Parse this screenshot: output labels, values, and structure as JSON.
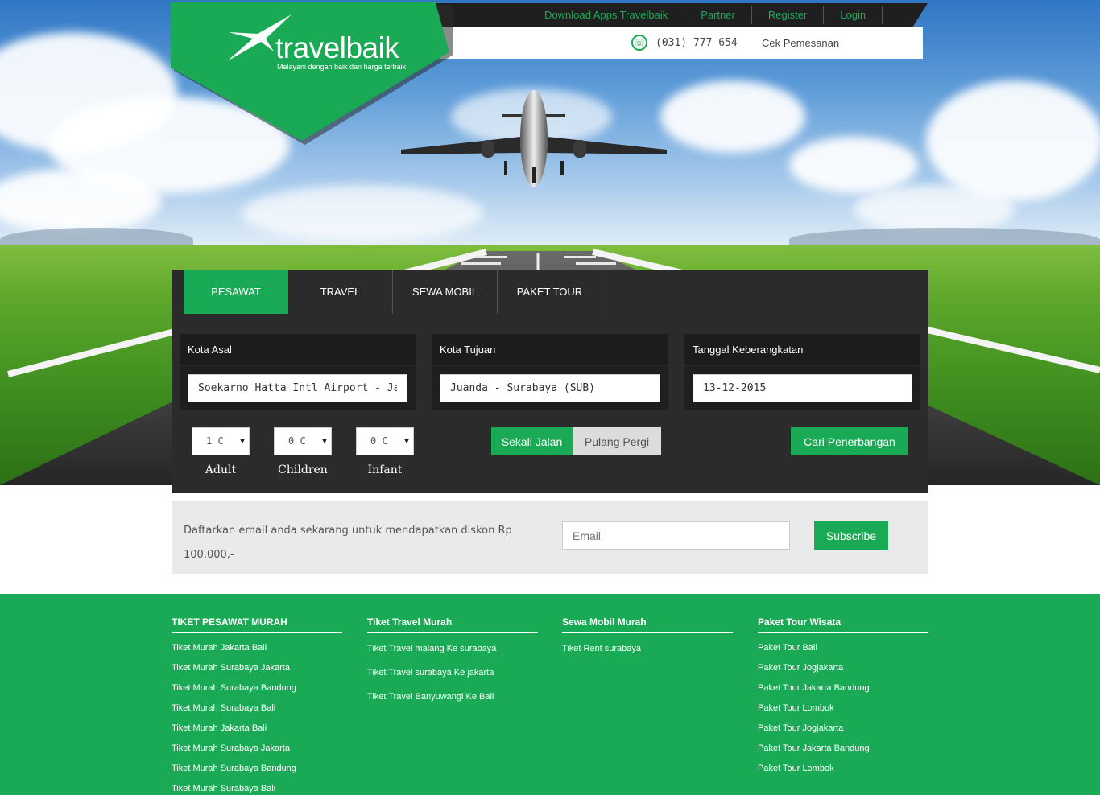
{
  "brand": {
    "name": "travelbaik",
    "tagline": "Melayani dengan baik dan harga terbaik"
  },
  "topnav": {
    "links": [
      "Download Apps Travelbaik",
      "Partner",
      "Register",
      "Login"
    ]
  },
  "info": {
    "phone": "(031) 777 654",
    "check_order": "Cek Pemesanan"
  },
  "tabs": [
    "PESAWAT",
    "TRAVEL",
    "SEWA MOBIL",
    "PAKET TOUR"
  ],
  "search": {
    "origin_label": "Kota Asal",
    "origin_value": "Soekarno Hatta Intl Airport - Jakarta",
    "dest_label": "Kota Tujuan",
    "dest_value": "Juanda - Surabaya (SUB)",
    "date_label": "Tanggal Keberangkatan",
    "date_value": "13-12-2015",
    "passengers": [
      {
        "value": "1 C",
        "label": "Adult"
      },
      {
        "value": "0 C",
        "label": "Children"
      },
      {
        "value": "0 C",
        "label": "Infant"
      }
    ],
    "trip_oneway": "Sekali Jalan",
    "trip_return": "Pulang Pergi",
    "submit": "Cari Penerbangan"
  },
  "subscribe": {
    "text": "Daftarkan email anda sekarang untuk mendapatkan diskon Rp 100.000,-",
    "placeholder": "Email",
    "button": "Subscribe"
  },
  "footer": {
    "columns": [
      {
        "title": "TIKET PESAWAT MURAH",
        "links": [
          "Tiket Murah Jakarta Bali",
          "Tiket Murah Surabaya Jakarta",
          "Tiket Murah Surabaya Bandung",
          "Tiket Murah Surabaya Bali",
          "Tiket Murah Jakarta Bali",
          "Tiket Murah Surabaya Jakarta",
          "Tiket Murah Surabaya Bandung",
          "Tiket Murah Surabaya Bali"
        ]
      },
      {
        "title": "Tiket Travel Murah",
        "links": [
          "Tiket Travel malang Ke surabaya",
          "Tiket Travel surabaya Ke jakarta",
          "Tiket Travel Banyuwangi Ke Bali"
        ]
      },
      {
        "title": "Sewa Mobil Murah",
        "links": [
          "Tiket Rent surabaya"
        ]
      },
      {
        "title": "Paket Tour Wisata",
        "links": [
          "Paket Tour Bali",
          "Paket Tour Jogjakarta",
          "Paket Tour Jakarta Bandung",
          "Paket Tour Lombok",
          "Paket Tour Jogjakarta",
          "Paket Tour Jakarta Bandung",
          "Paket Tour Lombok"
        ]
      }
    ]
  },
  "colors": {
    "brand_green": "#1aaa55",
    "panel_dark": "#2b2b2b"
  }
}
